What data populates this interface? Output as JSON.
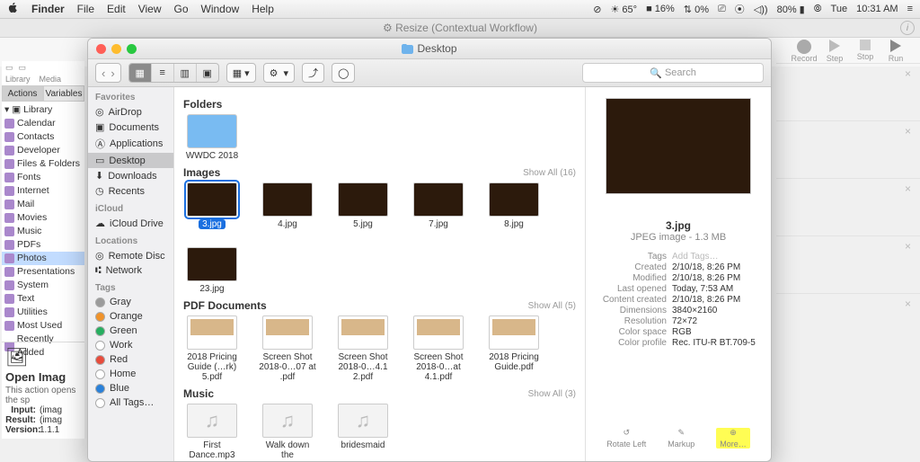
{
  "menubar": {
    "app": "Finder",
    "items": [
      "File",
      "Edit",
      "View",
      "Go",
      "Window",
      "Help"
    ],
    "status": {
      "temp": "65°",
      "battery1": "16%",
      "cpu": "0%",
      "battery2": "80%",
      "day": "Tue",
      "time": "10:31 AM"
    }
  },
  "bgwin": {
    "title": "Resize (Contextual Workflow)"
  },
  "record_toolbar": [
    "Record",
    "Step",
    "Stop",
    "Run"
  ],
  "automator": {
    "tabs": [
      "Actions",
      "Variables"
    ],
    "library_label": "Library",
    "items": [
      "Calendar",
      "Contacts",
      "Developer",
      "Files & Folders",
      "Fonts",
      "Internet",
      "Mail",
      "Movies",
      "Music",
      "PDFs",
      "Photos",
      "Presentations",
      "System",
      "Text",
      "Utilities",
      "Most Used",
      "Recently Added"
    ],
    "selected": "Photos",
    "footer": {
      "title": "Open Imag",
      "desc": "This action opens the sp",
      "rows": [
        [
          "Input:",
          "(imag"
        ],
        [
          "Result:",
          "(imag"
        ],
        [
          "Version:",
          "1.1.1"
        ]
      ]
    },
    "media_label": "Media",
    "library_btn": "Library"
  },
  "finder": {
    "title": "Desktop",
    "search_placeholder": "Search",
    "sidebar": {
      "Favorites": [
        "AirDrop",
        "Documents",
        "Applications",
        "Desktop",
        "Downloads",
        "Recents"
      ],
      "selected": "Desktop",
      "iCloud_label": "iCloud",
      "iCloud": [
        "iCloud Drive"
      ],
      "Locations": [
        "Remote Disc",
        "Network"
      ],
      "Tags_label": "Tags",
      "Tags": [
        {
          "name": "Gray",
          "color": "#9b9b9b"
        },
        {
          "name": "Orange",
          "color": "#f0932b"
        },
        {
          "name": "Green",
          "color": "#27ae60"
        },
        {
          "name": "Work",
          "color": "#ffffff"
        },
        {
          "name": "Red",
          "color": "#e74c3c"
        },
        {
          "name": "Home",
          "color": "#ffffff"
        },
        {
          "name": "Blue",
          "color": "#2980d9"
        },
        {
          "name": "All Tags…",
          "color": "#ffffff"
        }
      ]
    },
    "sections": {
      "folders": {
        "title": "Folders",
        "items": [
          "WWDC 2018"
        ]
      },
      "images": {
        "title": "Images",
        "showall": "Show All (16)",
        "items": [
          "3.jpg",
          "4.jpg",
          "5.jpg",
          "7.jpg",
          "8.jpg",
          "23.jpg"
        ],
        "selected": "3.jpg"
      },
      "pdfs": {
        "title": "PDF Documents",
        "showall": "Show All (5)",
        "items": [
          "2018 Pricing Guide (…rk) 5.pdf",
          "Screen Shot 2018-0…07 at .pdf",
          "Screen Shot 2018-0…4.1 2.pdf",
          "Screen Shot 2018-0…at 4.1.pdf",
          "2018 Pricing Guide.pdf"
        ]
      },
      "music": {
        "title": "Music",
        "showall": "Show All (3)",
        "items": [
          "First Dance.mp3",
          "Walk down the",
          "bridesmaid"
        ]
      }
    },
    "preview": {
      "filename": "3.jpg",
      "subtitle": "JPEG image - 1.3 MB",
      "add_tags": "Add Tags…",
      "meta": [
        [
          "Tags",
          ""
        ],
        [
          "Created",
          "2/10/18, 8:26 PM"
        ],
        [
          "Modified",
          "2/10/18, 8:26 PM"
        ],
        [
          "Last opened",
          "Today, 7:53 AM"
        ],
        [
          "Content created",
          "2/10/18, 8:26 PM"
        ],
        [
          "Dimensions",
          "3840×2160"
        ],
        [
          "Resolution",
          "72×72"
        ],
        [
          "Color space",
          "RGB"
        ],
        [
          "Color profile",
          "Rec. ITU-R BT.709-5"
        ]
      ],
      "actions": [
        "Rotate Left",
        "Markup",
        "More…"
      ]
    }
  }
}
